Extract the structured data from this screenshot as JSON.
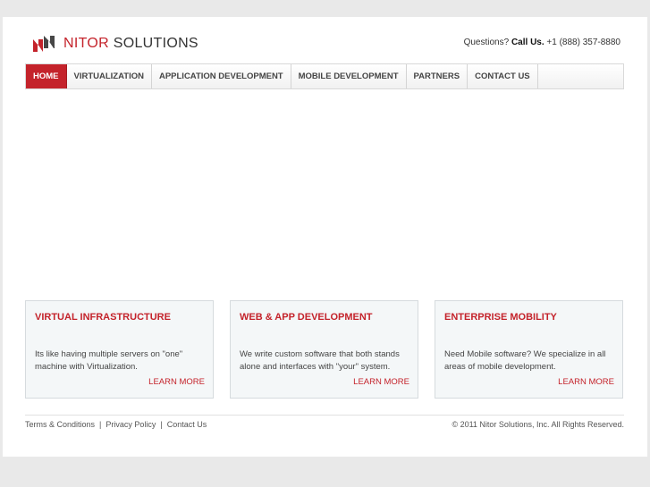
{
  "brand": {
    "part1": "NITOR",
    "part2": " SOLUTIONS",
    "logo_icon": "nitor-logo-icon",
    "accent_color": "#c4232b"
  },
  "header": {
    "question": "Questions?",
    "call_label": "Call Us.",
    "phone": "+1 (888) 357-8880"
  },
  "nav": {
    "items": [
      {
        "label": "HOME",
        "active": true
      },
      {
        "label": "VIRTUALIZATION"
      },
      {
        "label": "APPLICATION DEVELOPMENT"
      },
      {
        "label": "MOBILE DEVELOPMENT"
      },
      {
        "label": "PARTNERS"
      },
      {
        "label": "CONTACT US"
      }
    ]
  },
  "cards": [
    {
      "title": "VIRTUAL INFRASTRUCTURE",
      "text": "Its like having multiple servers on \"one\" machine with Virtualization.",
      "more": "LEARN MORE"
    },
    {
      "title": "WEB & APP DEVELOPMENT",
      "text": "We write custom software that both stands alone and interfaces with \"your\" system.",
      "more": "LEARN MORE"
    },
    {
      "title": "ENTERPRISE MOBILITY",
      "text": "Need Mobile software? We specialize in all areas of mobile development.",
      "more": "LEARN MORE"
    }
  ],
  "footer": {
    "links": [
      "Terms & Conditions",
      "Privacy Policy",
      "Contact Us"
    ],
    "separator": "|",
    "copyright": "© 2011 Nitor Solutions, Inc. All Rights Reserved."
  }
}
